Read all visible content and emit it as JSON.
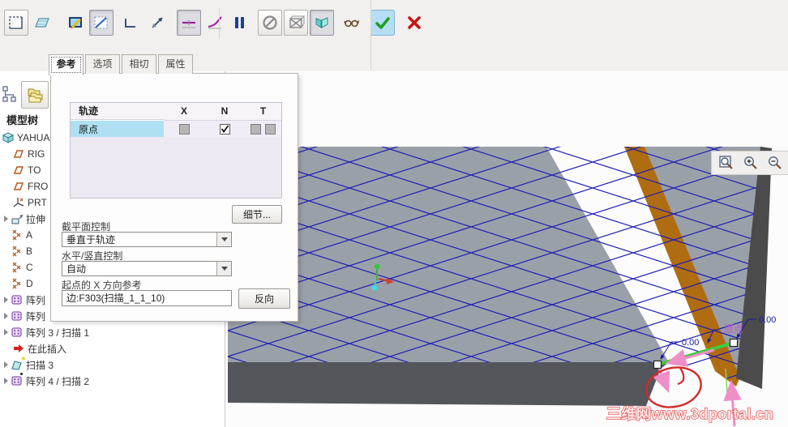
{
  "window": {
    "canvas_bg": "#fcfcfc",
    "chrome_bg": "#f1f0ee"
  },
  "top_toolbar": {
    "group1": [
      {
        "id": "sketch-plane",
        "state": "raised"
      },
      {
        "id": "quilt",
        "state": "flat"
      },
      {
        "id": "edit-sketch",
        "state": "flat"
      },
      {
        "id": "section",
        "state": "pressed"
      },
      {
        "id": "corner",
        "state": "flat"
      },
      {
        "id": "swap-dir",
        "state": "flat"
      },
      {
        "id": "const-section",
        "state": "pressed"
      },
      {
        "id": "var-section",
        "state": "flat"
      }
    ],
    "group2": [
      {
        "id": "pause",
        "state": "plain"
      },
      {
        "id": "no-preview",
        "state": "raised"
      },
      {
        "id": "wire-preview",
        "state": "raised"
      },
      {
        "id": "shaded-preview",
        "state": "pressed"
      },
      {
        "id": "glasses",
        "state": "plain"
      },
      {
        "id": "ok",
        "state": "accept"
      },
      {
        "id": "cancel",
        "state": "plain"
      }
    ]
  },
  "tabs": [
    {
      "name": "tab-references",
      "label": "参考",
      "active": true
    },
    {
      "name": "tab-options",
      "label": "选项",
      "active": false
    },
    {
      "name": "tab-tangency",
      "label": "相切",
      "active": false
    },
    {
      "name": "tab-properties",
      "label": "属性",
      "active": false
    }
  ],
  "panel": {
    "table": {
      "headers": [
        "轨迹",
        "X",
        "N",
        "T"
      ],
      "rows": [
        {
          "label": "原点",
          "x": "disabled",
          "n": "checked",
          "t": "disabled-pair"
        }
      ]
    },
    "details_button": "细节...",
    "section_control_label": "截平面控制",
    "section_control_value": "垂直于轨迹",
    "horizontal_control_label": "水平/竖直控制",
    "horizontal_control_value": "自动",
    "x_direction_label": "起点的 X 方向参考",
    "x_direction_value": "边:F303(扫描_1_1_10)",
    "flip_button": "反向"
  },
  "sidebar": {
    "title": "模型树",
    "items": [
      {
        "name": "tree-item-model-root",
        "label": "YAHUA",
        "icon": "part",
        "arrow": false,
        "indent": 0
      },
      {
        "name": "tree-item-plane-right",
        "label": "RIG",
        "icon": "plane",
        "arrow": false,
        "indent": 1
      },
      {
        "name": "tree-item-plane-top",
        "label": "TO",
        "icon": "plane",
        "arrow": false,
        "indent": 1
      },
      {
        "name": "tree-item-plane-front",
        "label": "FRO",
        "icon": "plane",
        "arrow": false,
        "indent": 1
      },
      {
        "name": "tree-item-csys",
        "label": "PRT",
        "icon": "csys",
        "arrow": false,
        "indent": 1
      },
      {
        "name": "tree-item-extrude",
        "label": "拉伸",
        "icon": "extrude",
        "arrow": true,
        "indent": 1
      },
      {
        "name": "tree-item-points-a",
        "label": "A",
        "icon": "points",
        "arrow": false,
        "indent": 2
      },
      {
        "name": "tree-item-points-b",
        "label": "B",
        "icon": "points",
        "arrow": false,
        "indent": 2
      },
      {
        "name": "tree-item-points-c",
        "label": "C",
        "icon": "points",
        "arrow": false,
        "indent": 2
      },
      {
        "name": "tree-item-points-d",
        "label": "D",
        "icon": "points",
        "arrow": false,
        "indent": 2
      },
      {
        "name": "tree-item-pattern-1",
        "label": "阵列",
        "icon": "pattern",
        "arrow": true,
        "indent": 1
      },
      {
        "name": "tree-item-pattern-2",
        "label": "阵列",
        "icon": "pattern",
        "arrow": true,
        "indent": 1
      },
      {
        "name": "tree-item-pattern-3",
        "label": "阵列 3 / 扫描 1",
        "icon": "pattern",
        "arrow": true,
        "indent": 1
      },
      {
        "name": "tree-item-insert-here",
        "label": "在此插入",
        "icon": "insert",
        "arrow": false,
        "indent": 1
      },
      {
        "name": "tree-item-sweep-3",
        "label": "扫描 3",
        "icon": "sweep",
        "badge": "asterisk",
        "arrow": true,
        "indent": 1
      },
      {
        "name": "tree-item-pattern-4",
        "label": "阵列 4 / 扫描 2",
        "icon": "pattern",
        "badge": "square",
        "arrow": true,
        "indent": 1
      }
    ]
  },
  "view_toolbar": [
    {
      "id": "zoom-box",
      "pressed": false
    },
    {
      "id": "zoom-in",
      "pressed": false
    },
    {
      "id": "zoom-out",
      "pressed": false
    },
    {
      "id": "repaint",
      "pressed": false
    },
    {
      "id": "display-style",
      "pressed": false
    },
    {
      "id": "saved-views",
      "pressed": false
    },
    {
      "id": "view-manager",
      "pressed": false
    },
    {
      "id": "datum-display",
      "pressed": false
    },
    {
      "id": "annotation-display",
      "pressed": true
    },
    {
      "id": "spin-center",
      "pressed": true
    }
  ],
  "scene": {
    "dim_a": "0.00",
    "dim_b": "0.00",
    "origin_label": "原点",
    "watermark": "三维网www.3dportal.cn",
    "colors": {
      "mesh": "#1d1db5",
      "surface": "#9aa0a8",
      "band": "#fcfcfc",
      "stripe": "#b06c10",
      "edge": "#4b4b4b",
      "front_face": "#53565b",
      "trajectory": "#3ecb3e",
      "arrows": "#ef8fc7",
      "dims": "#1a1aa8",
      "origin": "#cc4fd0",
      "annotation": "#d42a2a"
    }
  }
}
